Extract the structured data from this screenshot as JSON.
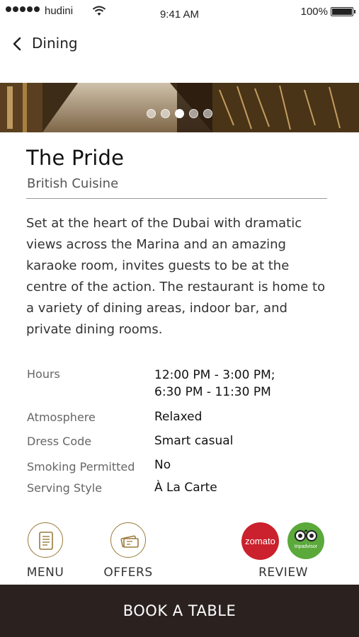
{
  "status_bar": {
    "carrier": "hudini",
    "time": "9:41 AM",
    "battery": "100%"
  },
  "nav": {
    "back_label": "Dining"
  },
  "hero": {
    "slide_count": 5,
    "active_slide": 3
  },
  "venue": {
    "name": "The Pride",
    "cuisine": "British Cuisine",
    "description": "Set at the heart of the Dubai with dramatic views across the Marina and an amazing karaoke room, invites guests to be at the centre of the action. The restaurant is home to a variety of dining areas, indoor bar, and private dining rooms."
  },
  "details": [
    {
      "label": "Hours",
      "value_line1": "12:00 PM - 3:00 PM;",
      "value_line2": "6:30 PM - 11:30 PM"
    },
    {
      "label": "Atmosphere",
      "value_line1": "Relaxed"
    },
    {
      "label": "Dress Code",
      "value_line1": "Smart casual"
    },
    {
      "label": "Smoking Permitted",
      "value_line1": "No"
    },
    {
      "label": "Serving Style",
      "value_line1": "À La Carte"
    }
  ],
  "actions": {
    "menu_label": "MENU",
    "offers_label": "OFFERS",
    "review_label": "REVIEW",
    "zomato_logo": "zomato",
    "tripadvisor_logo": "tripadvisor"
  },
  "footer": {
    "book_label": "BOOK A TABLE"
  },
  "colors": {
    "accent": "#9a7a3c",
    "footer": "#2b2220",
    "zomato": "#cb202d",
    "tripadvisor": "#5aa93a"
  }
}
